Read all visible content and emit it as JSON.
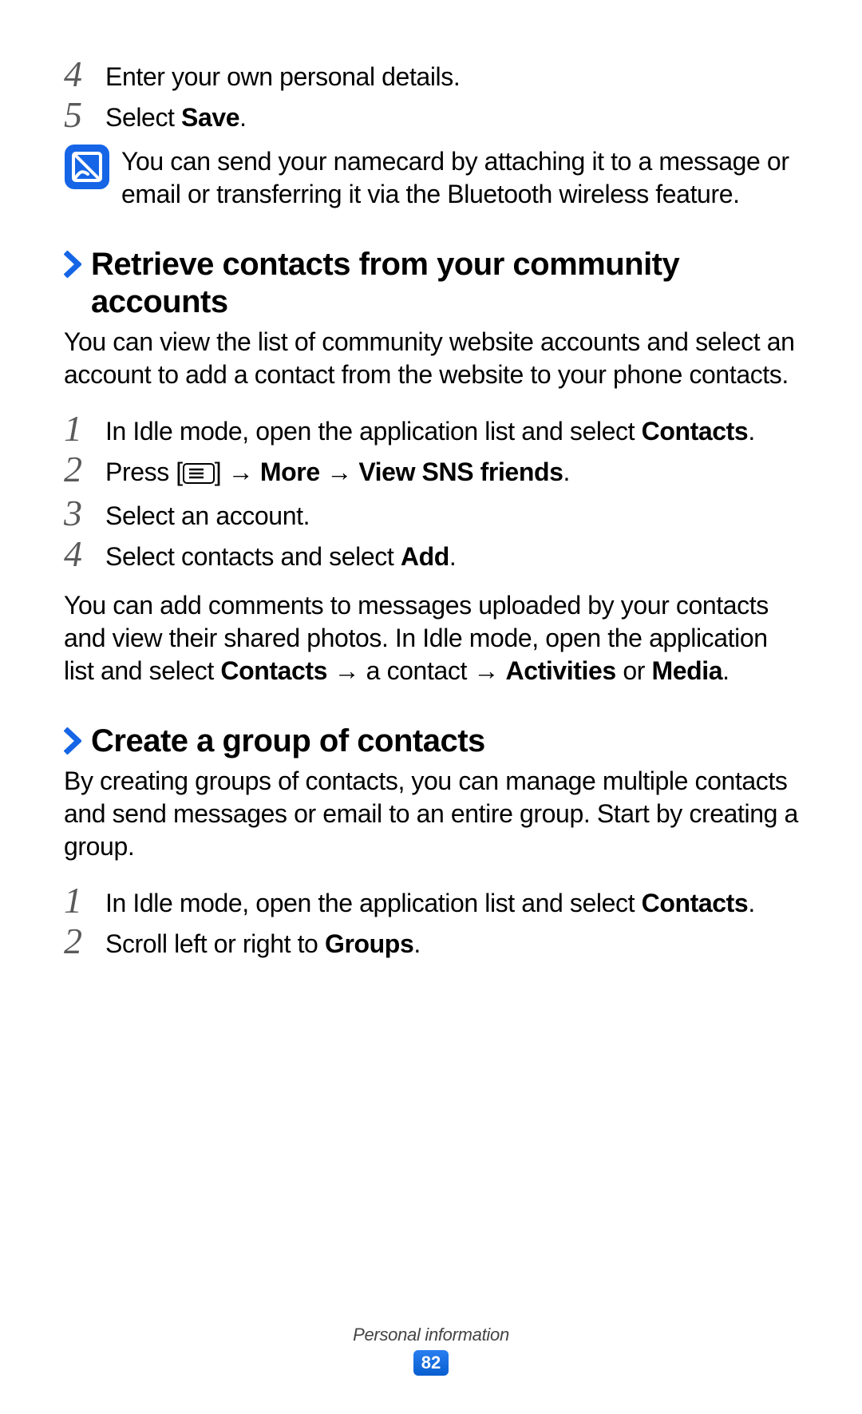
{
  "top_steps": [
    {
      "num": "4",
      "parts": [
        {
          "t": "Enter your own personal details."
        }
      ]
    },
    {
      "num": "5",
      "parts": [
        {
          "t": "Select "
        },
        {
          "t": "Save",
          "b": true
        },
        {
          "t": "."
        }
      ]
    }
  ],
  "note": {
    "parts": [
      {
        "t": "You can send your namecard by attaching it to a message or email or transferring it via the Bluetooth wireless feature."
      }
    ]
  },
  "sections": [
    {
      "title": "Retrieve contacts from your community accounts",
      "intro_parts": [
        {
          "t": "You can view the list of community website accounts and select an account to add a contact from the website to your phone contacts."
        }
      ],
      "steps": [
        {
          "num": "1",
          "parts": [
            {
              "t": "In Idle mode, open the application list and select "
            },
            {
              "t": "Contacts",
              "b": true
            },
            {
              "t": "."
            }
          ]
        },
        {
          "num": "2",
          "parts": [
            {
              "t": "Press ["
            },
            {
              "icon": "menu"
            },
            {
              "t": "] → "
            },
            {
              "t": "More",
              "b": true
            },
            {
              "t": " → "
            },
            {
              "t": "View SNS friends",
              "b": true
            },
            {
              "t": "."
            }
          ]
        },
        {
          "num": "3",
          "parts": [
            {
              "t": "Select an account."
            }
          ]
        },
        {
          "num": "4",
          "parts": [
            {
              "t": "Select contacts and select "
            },
            {
              "t": "Add",
              "b": true
            },
            {
              "t": "."
            }
          ]
        }
      ],
      "outro_parts": [
        {
          "t": "You can add comments to messages uploaded by your contacts and view their shared photos. In Idle mode, open the application list and select "
        },
        {
          "t": "Contacts",
          "b": true
        },
        {
          "t": " → a contact → "
        },
        {
          "t": "Activities",
          "b": true
        },
        {
          "t": " or "
        },
        {
          "t": "Media",
          "b": true
        },
        {
          "t": "."
        }
      ]
    },
    {
      "title": "Create a group of contacts",
      "intro_parts": [
        {
          "t": "By creating groups of contacts, you can manage multiple contacts and send messages or email to an entire group. Start by creating a group."
        }
      ],
      "steps": [
        {
          "num": "1",
          "parts": [
            {
              "t": "In Idle mode, open the application list and select "
            },
            {
              "t": "Contacts",
              "b": true
            },
            {
              "t": "."
            }
          ]
        },
        {
          "num": "2",
          "parts": [
            {
              "t": "Scroll left or right to "
            },
            {
              "t": "Groups",
              "b": true
            },
            {
              "t": "."
            }
          ]
        }
      ]
    }
  ],
  "footer": {
    "label": "Personal information",
    "page_number": "82"
  },
  "colors": {
    "accent": "#1565e6",
    "step_num": "#5a5a5a"
  }
}
